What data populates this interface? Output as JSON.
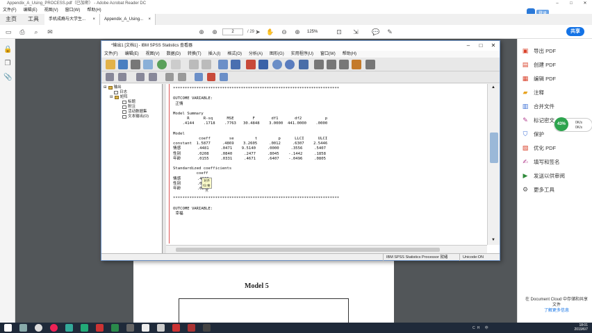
{
  "acrobat": {
    "title": "Appendix_A_Using_PROCESS.pdf（已加密） - Adobe Acrobat Reader DC",
    "menu": [
      "文件(F)",
      "编辑(E)",
      "视图(V)",
      "窗口(W)",
      "帮助(H)"
    ],
    "tabs": [
      "主页",
      "工具"
    ],
    "doc_tabs": [
      {
        "label": "手机成瘾与大学生...",
        "close": "×"
      },
      {
        "label": "Appendix_A_Using...",
        "close": "×"
      }
    ],
    "page_current": "2",
    "page_total": "/ 29",
    "zoom": "125%",
    "share_label": "共享",
    "user_label": "登录",
    "right_tools": [
      {
        "icon": "export-pdf-icon",
        "label": "导出 PDF",
        "color": "#d9412a"
      },
      {
        "icon": "create-pdf-icon",
        "label": "创建 PDF",
        "color": "#d9412a"
      },
      {
        "icon": "edit-pdf-icon",
        "label": "编辑 PDF",
        "color": "#d9412a"
      },
      {
        "icon": "comment-icon",
        "label": "注释",
        "color": "#e8a321"
      },
      {
        "icon": "combine-files-icon",
        "label": "合并文件",
        "color": "#3b6fd6"
      },
      {
        "icon": "stamp-icon",
        "label": "标记密文",
        "color": "#b03a8c"
      },
      {
        "icon": "protect-icon",
        "label": "保护",
        "color": "#3b6fd6"
      },
      {
        "icon": "optimize-pdf-icon",
        "label": "优化 PDF",
        "color": "#d9412a"
      },
      {
        "icon": "fill-sign-icon",
        "label": "填写和签名",
        "color": "#b03a8c"
      },
      {
        "icon": "send-review-icon",
        "label": "发送以供审阅",
        "color": "#2f8a3a"
      },
      {
        "icon": "more-tools-icon",
        "label": "更多工具",
        "color": "#555555"
      }
    ],
    "footer_text": "在 Document Cloud 中存储和共享文件",
    "footer_link": "了解更多信息",
    "perf_percent": "43%",
    "perf_up": "0K/s",
    "perf_down": "0K/s",
    "pdf_heading": "Model 5"
  },
  "spss": {
    "title": "*输出1 [文档1] - IBM SPSS Statistics 查看器",
    "menu": [
      "文件(F)",
      "编辑(E)",
      "视图(V)",
      "数据(D)",
      "转换(T)",
      "插入(I)",
      "格式(O)",
      "分析(A)",
      "图形(G)",
      "实用程序(U)",
      "窗口(W)",
      "帮助(H)"
    ],
    "tree": [
      {
        "label": "输出",
        "level": 0
      },
      {
        "label": "日志",
        "level": 1
      },
      {
        "label": "矩阵",
        "level": 1
      },
      {
        "label": "标题",
        "level": 2
      },
      {
        "label": "附注",
        "level": 2
      },
      {
        "label": "活动数据集",
        "level": 2
      },
      {
        "label": "文本输出(O)",
        "level": 2
      }
    ],
    "output_text": "***********************************************************************\n\nOUTCOME VARIABLE:\n 正情\n\nModel Summary\n      R      R-sq      MSE        F       df1       df2          p\n    .4144    .1718    .7763   30.4848    3.0000  441.0000    .0000\n\nModel\n           coeff        se         t         p      LLCI      ULCI\nconstant  1.5877     .4869    3.2605     .0012     .6307    2.5446\n情感       .4481     .0471    9.5140     .0000     .3556     .5407\n性别       .0208     .0840     .2477     .8045    -.1442     .1858\n年龄       .0155     .0331     .4671     .6407    -.0496     .0805\n\nStandardized coefficients\n          coeff\n情感       .4133\n性别       .0108\n年龄       .0203\n\n***********************************************************************\n\nOUTCOME VARIABLE:\n 幸福",
    "tooltip": "对齐归\n要点",
    "status_main": "IBM SPSS Statistics Processor 就绪",
    "status_unicode": "Unicode:ON"
  },
  "taskbar": {
    "time": "18:01",
    "date": "2019/6/7",
    "tray_text": "CH 中"
  }
}
